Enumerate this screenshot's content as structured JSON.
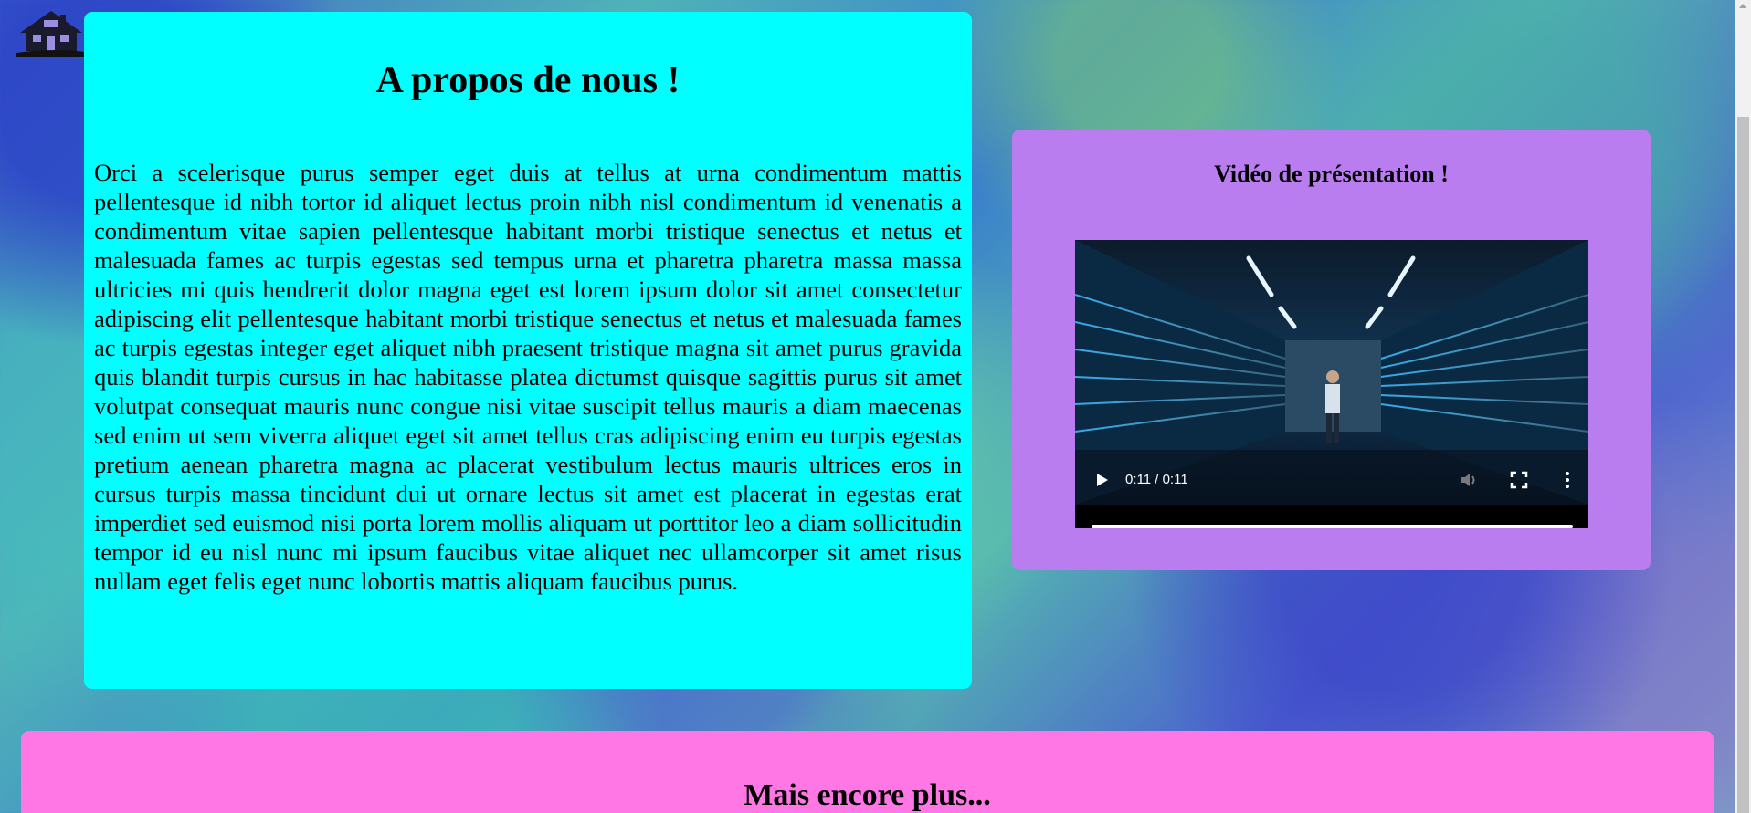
{
  "header": {
    "logo_icon": "house-icon"
  },
  "about": {
    "title": "A propos de nous !",
    "text": "Orci a scelerisque purus semper eget duis at tellus at urna condimentum mattis pellentesque id nibh tortor id aliquet lectus proin nibh nisl condimentum id venenatis a condimentum vitae sapien pellentesque habitant morbi tristique senectus et netus et malesuada fames ac turpis egestas sed tempus urna et pharetra pharetra massa massa ultricies mi quis hendrerit dolor magna eget est lorem ipsum dolor sit amet consectetur adipiscing elit pellentesque habitant morbi tristique senectus et netus et malesuada fames ac turpis egestas integer eget aliquet nibh praesent tristique magna sit amet purus gravida quis blandit turpis cursus in hac habitasse platea dictumst quisque sagittis purus sit amet volutpat consequat mauris nunc congue nisi vitae suscipit tellus mauris a diam maecenas sed enim ut sem viverra aliquet eget sit amet tellus cras adipiscing enim eu turpis egestas pretium aenean pharetra magna ac placerat vestibulum lectus mauris ultrices eros in cursus turpis massa tincidunt dui ut ornare lectus sit amet est placerat in egestas erat imperdiet sed euismod nisi porta lorem mollis aliquam ut porttitor leo a diam sollicitudin tempor id eu nisl nunc mi ipsum faucibus vitae aliquet nec ullamcorper sit amet risus nullam eget felis eget nunc lobortis mattis aliquam faucibus purus.",
    "card_color": "#00ffff"
  },
  "video": {
    "title": "Vidéo de présentation !",
    "time": "0:11 / 0:11",
    "progress_fraction": 1.0,
    "card_color": "#b97df0",
    "icons": [
      "play-icon",
      "volume-icon",
      "fullscreen-icon",
      "more-options-icon"
    ]
  },
  "more": {
    "title": "Mais encore plus...",
    "card_color": "#ff77e4"
  }
}
